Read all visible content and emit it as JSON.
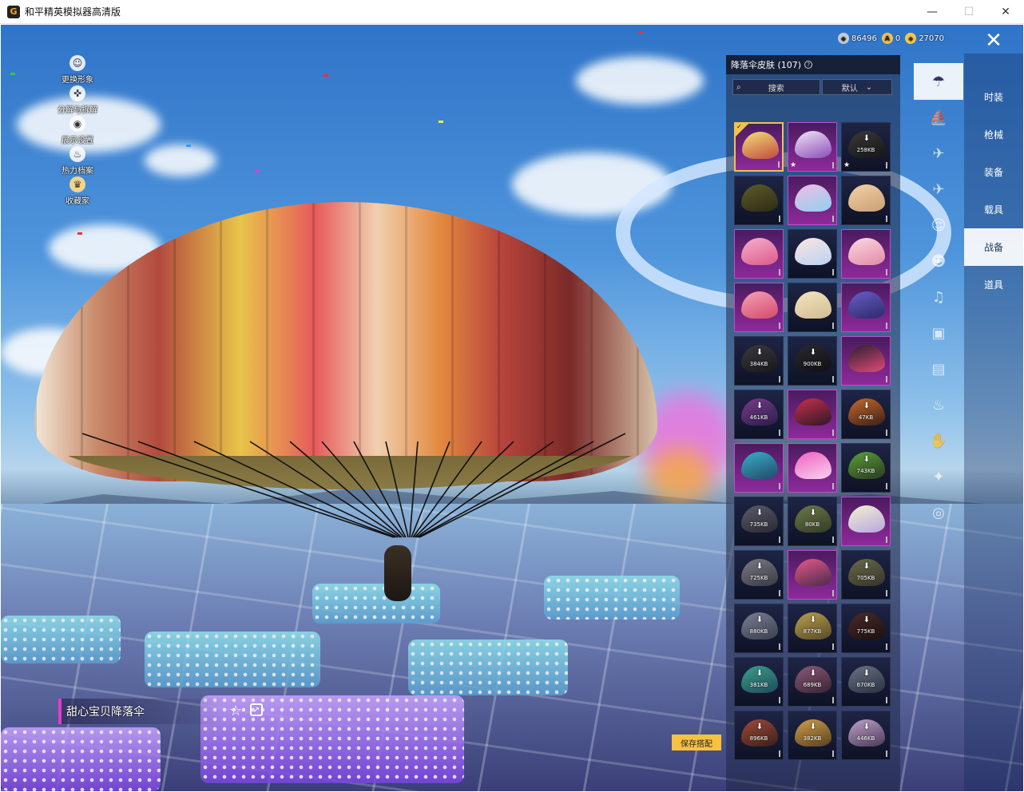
{
  "window": {
    "title": "和平精英模拟器高清版",
    "icon_letter": "G"
  },
  "currency": [
    {
      "value": "86496",
      "color": "#c7cbd6"
    },
    {
      "value": "0",
      "color": "#f2c14e"
    },
    {
      "value": "27070",
      "color": "#f5c84c"
    }
  ],
  "side_menu": [
    {
      "label": "更换形象",
      "icon": "person-icon"
    },
    {
      "label": "分解与拆解",
      "icon": "split-icon"
    },
    {
      "label": "展示设置",
      "icon": "eye-icon"
    },
    {
      "label": "热力档案",
      "icon": "flame-icon"
    },
    {
      "label": "收藏家",
      "icon": "collector-icon"
    }
  ],
  "panel": {
    "title": "降落伞皮肤 (107)",
    "search_label": "搜索",
    "sort_label": "默认"
  },
  "grid": [
    {
      "type": "legend",
      "selected": true,
      "colors": [
        "#f3e07a",
        "#c24a3b"
      ]
    },
    {
      "type": "legend",
      "star": true,
      "colors": [
        "#f1e6f7",
        "#8a4fb8"
      ]
    },
    {
      "type": "normal",
      "download": true,
      "size": "258KB",
      "star": true,
      "colors": [
        "#3a3a3a",
        "#151515"
      ]
    },
    {
      "type": "normal",
      "colors": [
        "#5c5a2a",
        "#2e2c14"
      ]
    },
    {
      "type": "legend",
      "colors": [
        "#f2bce6",
        "#8fd0ef"
      ]
    },
    {
      "type": "normal",
      "colors": [
        "#f3d2a8",
        "#c99f74"
      ]
    },
    {
      "type": "legend",
      "colors": [
        "#f6b0cd",
        "#dc5a8a"
      ]
    },
    {
      "type": "normal",
      "colors": [
        "#fbe6e0",
        "#bad2f2"
      ]
    },
    {
      "type": "legend",
      "colors": [
        "#fbd8e2",
        "#e28aa4"
      ]
    },
    {
      "type": "legend",
      "colors": [
        "#f5a2b8",
        "#d44a6a"
      ]
    },
    {
      "type": "normal",
      "colors": [
        "#f5e4c2",
        "#d2bd8f"
      ]
    },
    {
      "type": "legend",
      "colors": [
        "#6a5dc8",
        "#2b2a6a"
      ]
    },
    {
      "type": "normal",
      "download": true,
      "size": "384KB",
      "colors": [
        "#3a3a3e",
        "#18181c"
      ]
    },
    {
      "type": "normal",
      "download": true,
      "size": "900KB",
      "colors": [
        "#2a2a2e",
        "#101014"
      ]
    },
    {
      "type": "legend",
      "colors": [
        "#2a1e2e",
        "#e04a7a"
      ]
    },
    {
      "type": "normal",
      "download": true,
      "size": "461KB",
      "colors": [
        "#7a3a8a",
        "#2a1e4a"
      ]
    },
    {
      "type": "legend",
      "colors": [
        "#c8304a",
        "#301828"
      ]
    },
    {
      "type": "normal",
      "download": true,
      "size": "47KB",
      "colors": [
        "#c86a2a",
        "#3a2018"
      ]
    },
    {
      "type": "legend",
      "colors": [
        "#3ab0c8",
        "#204a6a"
      ]
    },
    {
      "type": "legend",
      "colors": [
        "#f060c0",
        "#f9d2ee"
      ]
    },
    {
      "type": "normal",
      "download": true,
      "size": "743KB",
      "colors": [
        "#5aa03a",
        "#2a3a20"
      ]
    },
    {
      "type": "normal",
      "download": true,
      "size": "735KB",
      "colors": [
        "#5a5a6a",
        "#2a2a34"
      ]
    },
    {
      "type": "normal",
      "download": true,
      "size": "80KB",
      "colors": [
        "#6a7a4a",
        "#343c24"
      ]
    },
    {
      "type": "legend",
      "colors": [
        "#f3f0d0",
        "#b8a7e0"
      ]
    },
    {
      "type": "normal",
      "download": true,
      "size": "725KB",
      "colors": [
        "#7a7a84",
        "#3a3a44"
      ]
    },
    {
      "type": "legend",
      "colors": [
        "#e65a8a",
        "#4a2a4a"
      ]
    },
    {
      "type": "normal",
      "download": true,
      "size": "705KB",
      "colors": [
        "#6a6a4a",
        "#34342a"
      ]
    },
    {
      "type": "normal",
      "download": true,
      "size": "880KB",
      "colors": [
        "#7a8094",
        "#3a3e4c"
      ]
    },
    {
      "type": "normal",
      "download": true,
      "size": "877KB",
      "colors": [
        "#b8a050",
        "#5a4a24"
      ]
    },
    {
      "type": "normal",
      "download": true,
      "size": "775KB",
      "colors": [
        "#4a2a2a",
        "#1c1010"
      ]
    },
    {
      "type": "normal",
      "download": true,
      "size": "381KB",
      "colors": [
        "#3aa08a",
        "#204a5a"
      ]
    },
    {
      "type": "normal",
      "download": true,
      "size": "689KB",
      "colors": [
        "#8a5a7a",
        "#3a2434"
      ]
    },
    {
      "type": "normal",
      "download": true,
      "size": "670KB",
      "colors": [
        "#6a7484",
        "#2a3040"
      ]
    },
    {
      "type": "normal",
      "download": true,
      "size": "896KB",
      "colors": [
        "#a04a3a",
        "#3a2018"
      ]
    },
    {
      "type": "normal",
      "download": true,
      "size": "382KB",
      "colors": [
        "#d0a04a",
        "#5a4020"
      ]
    },
    {
      "type": "normal",
      "download": true,
      "size": "446KB",
      "colors": [
        "#c0a0c8",
        "#4a3a5a"
      ]
    }
  ],
  "rail": [
    {
      "icon": "parachute-icon",
      "glyph": "☂",
      "active": true
    },
    {
      "icon": "boat-icon",
      "glyph": "⛵"
    },
    {
      "icon": "drone-icon",
      "glyph": "✈"
    },
    {
      "icon": "plane-icon",
      "glyph": "✈"
    },
    {
      "icon": "emote-icon",
      "glyph": "☺"
    },
    {
      "icon": "robot-icon",
      "glyph": "☻"
    },
    {
      "icon": "speaker-icon",
      "glyph": "♫"
    },
    {
      "icon": "chat-icon",
      "glyph": "▣"
    },
    {
      "icon": "photo-icon",
      "glyph": "▤"
    },
    {
      "icon": "extinguisher-icon",
      "glyph": "♨"
    },
    {
      "icon": "hand-icon",
      "glyph": "✋"
    },
    {
      "icon": "wand-icon",
      "glyph": "✦"
    },
    {
      "icon": "ufo-icon",
      "glyph": "◎"
    }
  ],
  "tabs": [
    {
      "label": "时装"
    },
    {
      "label": "枪械"
    },
    {
      "label": "装备"
    },
    {
      "label": "载具"
    },
    {
      "label": "战备",
      "active": true
    },
    {
      "label": "道具"
    }
  ],
  "bottom": {
    "skin_name": "甜心宝贝降落伞",
    "save_label": "保存搭配"
  },
  "colors": {
    "accent": "#f7c23c",
    "legend_border": "#c04bd0",
    "selected_border": "#f2c14e"
  }
}
